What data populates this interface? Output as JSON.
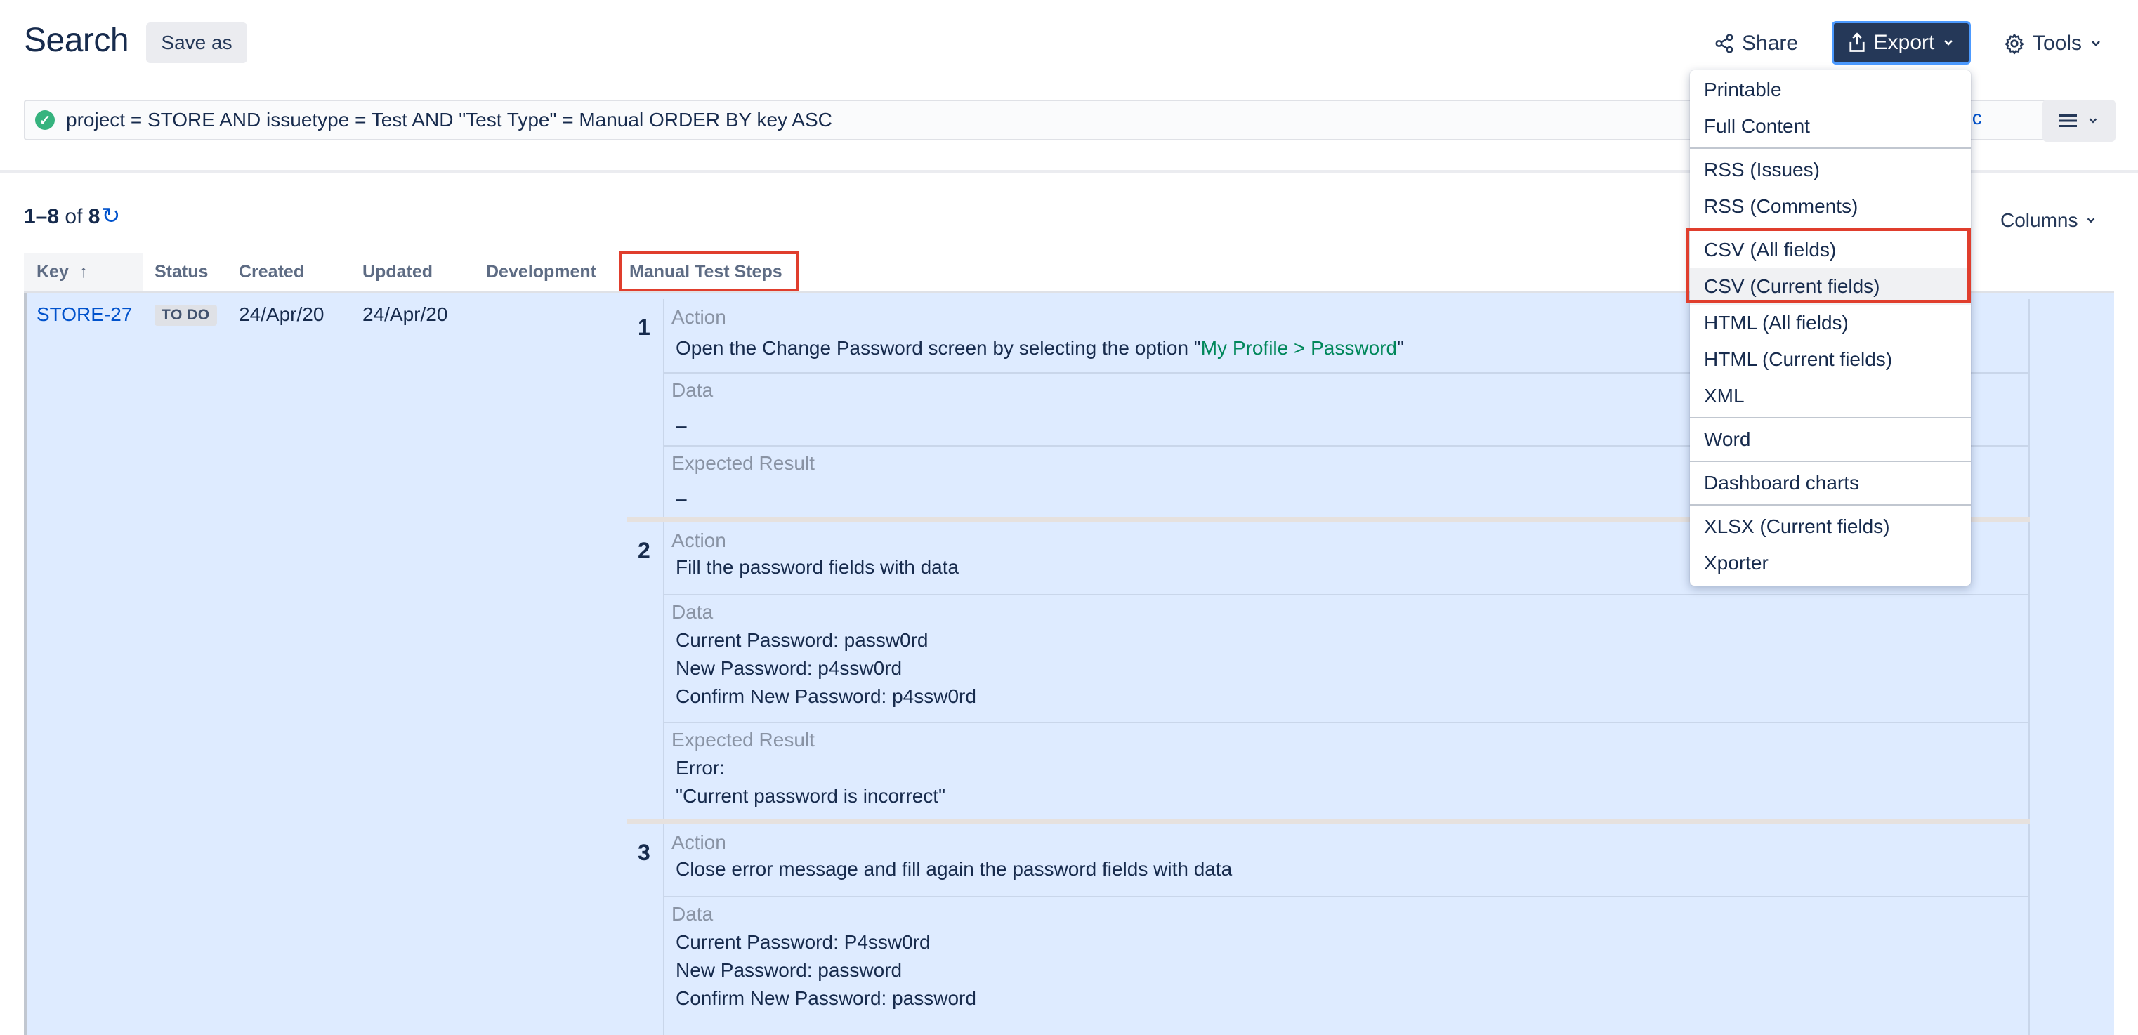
{
  "header": {
    "title": "Search",
    "save_as": "Save as",
    "share": "Share",
    "export": "Export",
    "tools": "Tools"
  },
  "jql": {
    "query": "project = STORE AND issuetype = Test AND \"Test Type\" = Manual ORDER BY key ASC",
    "basic_link": "asic"
  },
  "results": {
    "range": "1–8",
    "of": "of",
    "total": "8",
    "columns_label": "Columns"
  },
  "table": {
    "headers": {
      "key": "Key",
      "status": "Status",
      "created": "Created",
      "updated": "Updated",
      "development": "Development",
      "manual_test_steps": "Manual Test Steps"
    },
    "row": {
      "key": "STORE-27",
      "status": "TO DO",
      "created": "24/Apr/20",
      "updated": "24/Apr/20"
    }
  },
  "steps": [
    {
      "number": "1",
      "action_label": "Action",
      "action_prefix": "Open the Change Password screen by selecting the option \"",
      "action_link": "My Profile > Password",
      "action_suffix": "\"",
      "data_label": "Data",
      "data": "–",
      "expected_label": "Expected Result",
      "expected": "–"
    },
    {
      "number": "2",
      "action_label": "Action",
      "action": "Fill the password fields with data",
      "data_label": "Data",
      "data": "Current Password: passw0rd\nNew Password: p4ssw0rd\nConfirm New Password: p4ssw0rd",
      "expected_label": "Expected Result",
      "expected": "Error:\n\"Current password is incorrect\""
    },
    {
      "number": "3",
      "action_label": "Action",
      "action": "Close error message and fill again the password fields with data",
      "data_label": "Data",
      "data": "Current Password: P4ssw0rd\nNew Password: password\nConfirm New Password: password"
    }
  ],
  "export_menu": {
    "printable": "Printable",
    "full_content": "Full Content",
    "rss_issues": "RSS (Issues)",
    "rss_comments": "RSS (Comments)",
    "csv_all": "CSV (All fields)",
    "csv_current": "CSV (Current fields)",
    "html_all": "HTML (All fields)",
    "html_current": "HTML (Current fields)",
    "xml": "XML",
    "word": "Word",
    "dashboard_charts": "Dashboard charts",
    "xlsx_current": "XLSX (Current fields)",
    "xporter": "Xporter"
  },
  "colors": {
    "brand_dark": "#253858",
    "link": "#0052cc",
    "highlight": "#e03e2d",
    "row_selected": "#deebff",
    "success": "#36b37e"
  }
}
